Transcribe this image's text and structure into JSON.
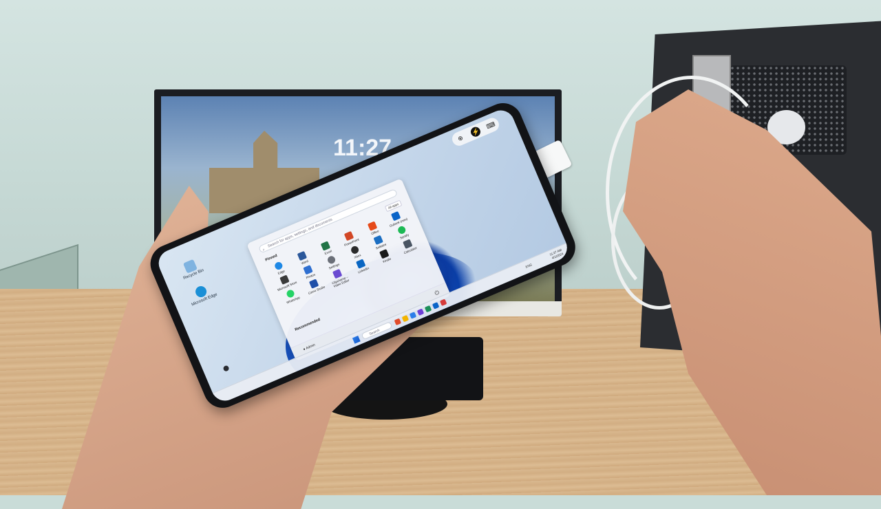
{
  "monitor": {
    "clock": "11:27"
  },
  "phone": {
    "desktop_icons": [
      {
        "label": "Recycle Bin",
        "color": "#7fb3e0"
      },
      {
        "label": "Microsoft Edge",
        "color": "#1a8fd6"
      }
    ],
    "start_menu": {
      "search_placeholder": "Search for apps, settings, and documents",
      "pinned_label": "Pinned",
      "all_apps_label": "All apps",
      "apps": [
        {
          "label": "Edge",
          "color": "#1e88e5"
        },
        {
          "label": "Word",
          "color": "#2b579a"
        },
        {
          "label": "Excel",
          "color": "#217346"
        },
        {
          "label": "PowerPoint",
          "color": "#d24726"
        },
        {
          "label": "Office",
          "color": "#e64a19"
        },
        {
          "label": "Outlook (new)",
          "color": "#0a64c8"
        },
        {
          "label": "Microsoft Store",
          "color": "#3a3a3a"
        },
        {
          "label": "Photos",
          "color": "#2f6fd0"
        },
        {
          "label": "Settings",
          "color": "#6b6f78"
        },
        {
          "label": "Xbox",
          "color": "#2a2a2a"
        },
        {
          "label": "Solitaire",
          "color": "#1b6ec2"
        },
        {
          "label": "Spotify",
          "color": "#1db954"
        },
        {
          "label": "WhatsApp",
          "color": "#25d366"
        },
        {
          "label": "Camo Studio",
          "color": "#1f4fa8"
        },
        {
          "label": "Clipchamp – Video Editor",
          "color": "#6a4bd1"
        },
        {
          "label": "LinkedIn",
          "color": "#0a66c2"
        },
        {
          "label": "Kindle",
          "color": "#1a1a1a"
        },
        {
          "label": "Calculator",
          "color": "#4a5563"
        }
      ],
      "recommended_label": "Recommended",
      "user_name": "Admin",
      "power_icon": "power-icon"
    },
    "taskbar": {
      "search_placeholder": "Search",
      "icon_colors": [
        "#e04b2b",
        "#f3b400",
        "#2b7de9",
        "#6c3fd4",
        "#1d8f5a",
        "#0a64c8",
        "#d63b3b"
      ],
      "language": "ENG",
      "time": "11:27 AM",
      "date": "4/2/2024"
    },
    "overlay_tools": [
      "zoom-icon",
      "lightning-icon",
      "keyboard-icon"
    ]
  }
}
